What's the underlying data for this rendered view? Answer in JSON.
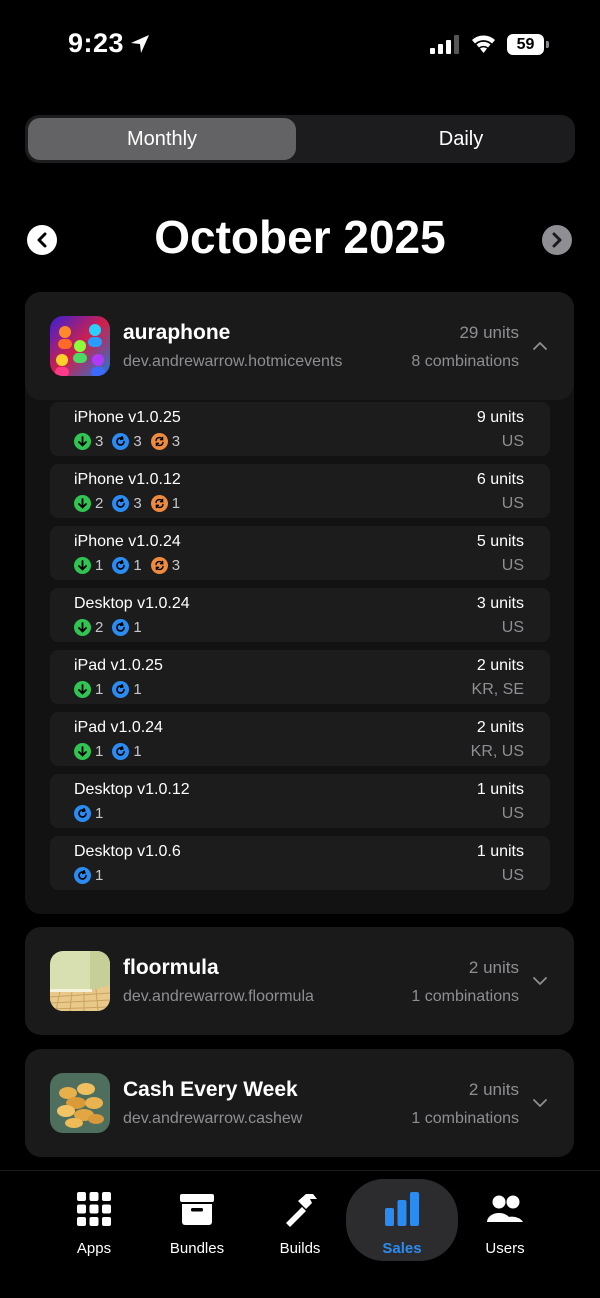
{
  "status": {
    "time": "9:23",
    "battery": "59"
  },
  "segments": {
    "monthly": "Monthly",
    "daily": "Daily"
  },
  "month": {
    "title": "October 2025"
  },
  "apps": [
    {
      "name": "auraphone",
      "bundle": "dev.andrewarrow.hotmicevents",
      "units": "29 units",
      "combinations": "8 combinations",
      "versions": [
        {
          "name": "iPhone v1.0.25",
          "units": "9 units",
          "country": "US",
          "downloads": "3",
          "updates": "3",
          "redownloads": "3"
        },
        {
          "name": "iPhone v1.0.12",
          "units": "6 units",
          "country": "US",
          "downloads": "2",
          "updates": "3",
          "redownloads": "1"
        },
        {
          "name": "iPhone v1.0.24",
          "units": "5 units",
          "country": "US",
          "downloads": "1",
          "updates": "1",
          "redownloads": "3"
        },
        {
          "name": "Desktop v1.0.24",
          "units": "3 units",
          "country": "US",
          "downloads": "2",
          "updates": "1"
        },
        {
          "name": "iPad v1.0.25",
          "units": "2 units",
          "country": "KR, SE",
          "downloads": "1",
          "updates": "1"
        },
        {
          "name": "iPad v1.0.24",
          "units": "2 units",
          "country": "KR, US",
          "downloads": "1",
          "updates": "1"
        },
        {
          "name": "Desktop v1.0.12",
          "units": "1 units",
          "country": "US",
          "updates": "1"
        },
        {
          "name": "Desktop v1.0.6",
          "units": "1 units",
          "country": "US",
          "updates": "1"
        }
      ]
    },
    {
      "name": "floormula",
      "bundle": "dev.andrewarrow.floormula",
      "units": "2 units",
      "combinations": "1 combinations"
    },
    {
      "name": "Cash Every Week",
      "bundle": "dev.andrewarrow.cashew",
      "units": "2 units",
      "combinations": "1 combinations"
    }
  ],
  "tabs": [
    {
      "label": "Apps",
      "icon": "grid-icon"
    },
    {
      "label": "Bundles",
      "icon": "archive-box-icon"
    },
    {
      "label": "Builds",
      "icon": "hammer-icon"
    },
    {
      "label": "Sales",
      "icon": "bar-chart-icon"
    },
    {
      "label": "Users",
      "icon": "users-icon"
    }
  ],
  "colors": {
    "accent": "#2a8cf0",
    "download": "#30c552",
    "update": "#2a8cf0",
    "redownload": "#f08a3c"
  }
}
